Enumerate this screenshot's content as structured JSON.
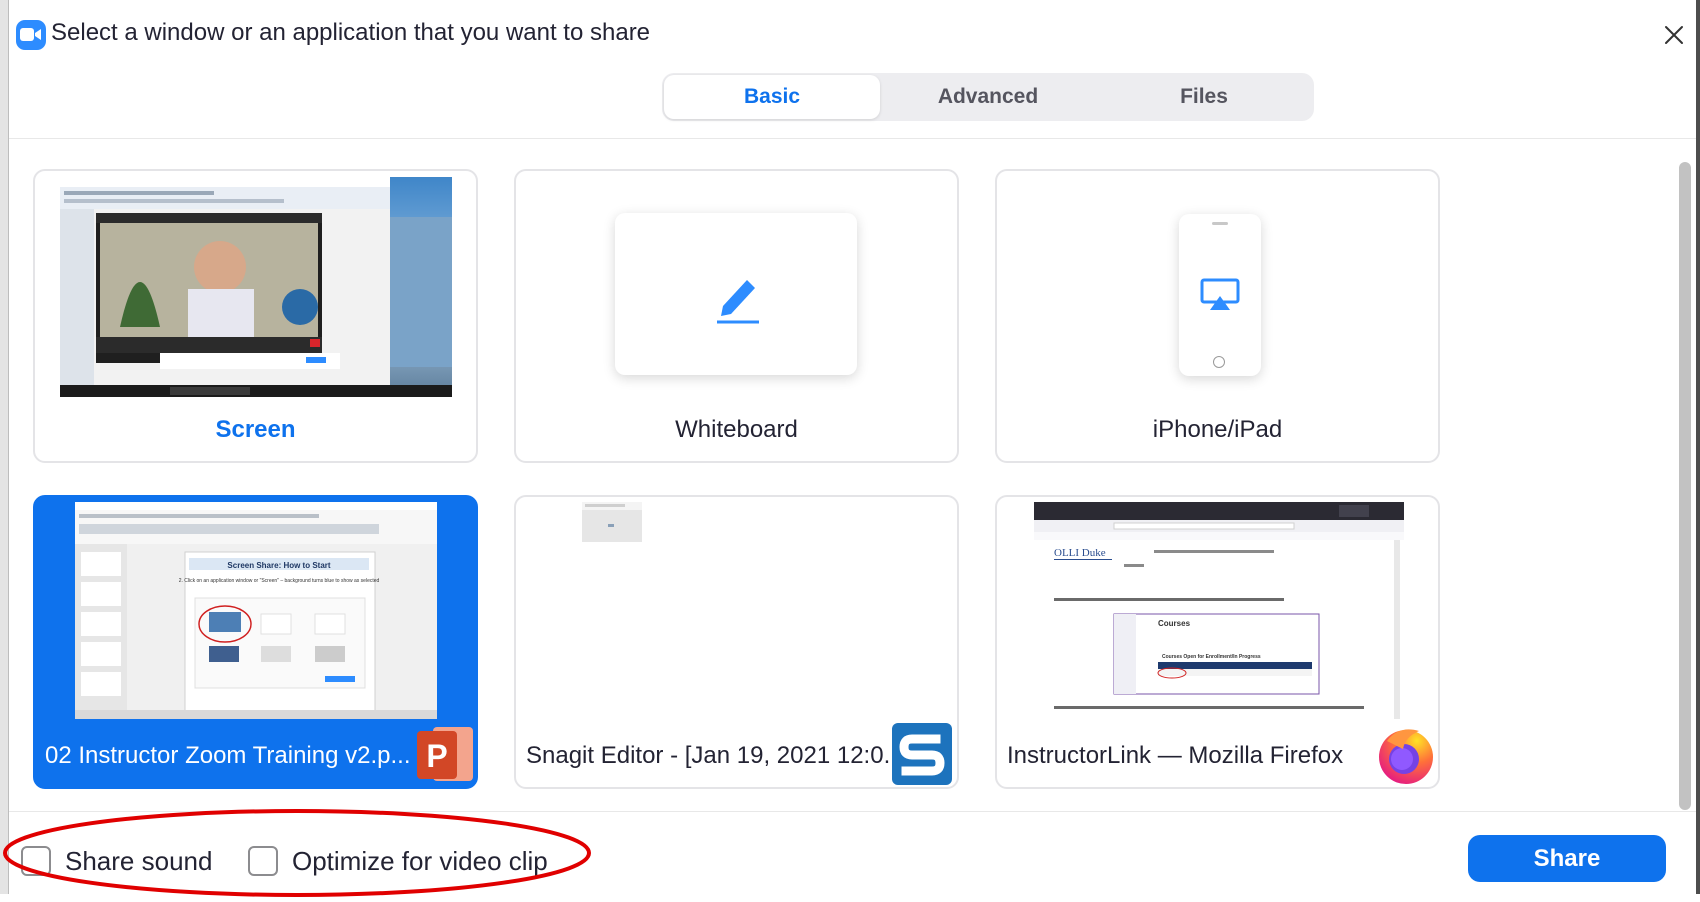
{
  "window": {
    "title": "Select a window or an application that you want to share",
    "accent_color": "#0e72ed",
    "logo_icon": "zoom-camera-icon",
    "close_icon": "close-icon"
  },
  "tabs": [
    {
      "label": "Basic",
      "active": true
    },
    {
      "label": "Advanced",
      "active": false
    },
    {
      "label": "Files",
      "active": false
    }
  ],
  "share_sources": [
    {
      "label": "Screen",
      "kind": "screen",
      "selected": false,
      "icon": "screen-thumbnail"
    },
    {
      "label": "Whiteboard",
      "kind": "whiteboard",
      "selected": false,
      "icon": "pencil-icon"
    },
    {
      "label": "iPhone/iPad",
      "kind": "device",
      "selected": false,
      "icon": "airplay-icon"
    },
    {
      "label": "02 Instructor Zoom Training v2.p...",
      "kind": "application",
      "selected": true,
      "icon": "powerpoint-icon"
    },
    {
      "label": "Snagit Editor - [Jan 19, 2021 12:0...",
      "kind": "application",
      "selected": false,
      "icon": "snagit-icon"
    },
    {
      "label": "InstructorLink — Mozilla Firefox",
      "kind": "application",
      "selected": false,
      "icon": "firefox-icon"
    }
  ],
  "thumb_text": {
    "slide_title": "Screen Share: How to Start",
    "slide_body": "2. Click on an application window or \"Screen\" – background turns blue to show as selected",
    "courses_heading": "Courses",
    "courses_sub": "Courses Open for Enrollment/In Progress",
    "site_logo": "OLLI Duke"
  },
  "options": [
    {
      "label": "Share sound",
      "checked": false
    },
    {
      "label": "Optimize for video clip",
      "checked": false
    }
  ],
  "share_button": {
    "label": "Share"
  },
  "annotation": {
    "shape": "ellipse",
    "color": "#e00000"
  }
}
